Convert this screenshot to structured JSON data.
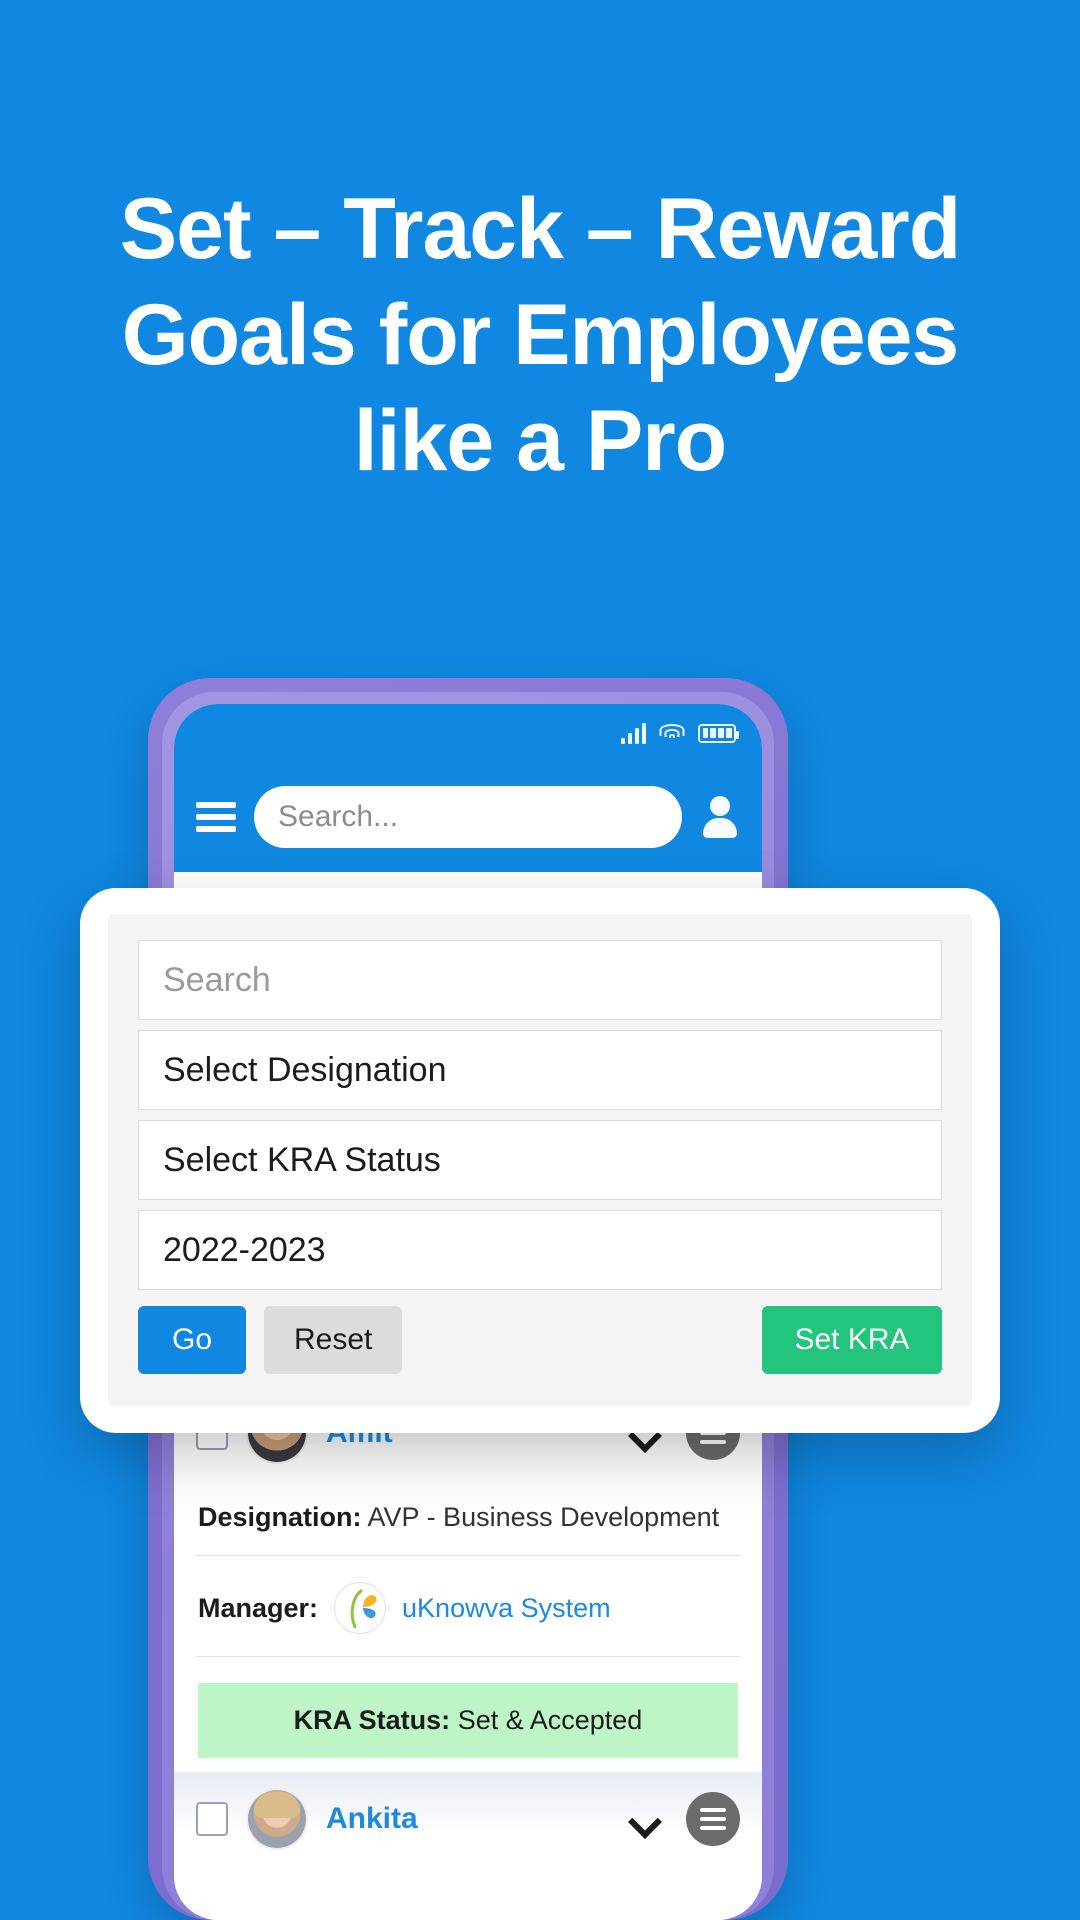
{
  "hero": {
    "line1": "Set – Track – Reward",
    "line2": "Goals for Employees",
    "line3": "like a Pro",
    "bg_color": "#1087e0",
    "text_color": "#ffffff"
  },
  "phone": {
    "frame_color": "#8f7fd8",
    "statusbar": {
      "signal_icon": "signal-bars-icon",
      "wifi_icon": "wifi-icon",
      "battery_icon": "battery-icon"
    },
    "app_header": {
      "menu_icon": "hamburger-icon",
      "search_placeholder": "Search...",
      "profile_icon": "user-avatar-icon",
      "bg_color": "#1087e0"
    }
  },
  "modal": {
    "fields": [
      {
        "name": "search",
        "value": "Search",
        "is_placeholder": true
      },
      {
        "name": "designation",
        "value": "Select Designation",
        "is_placeholder": false
      },
      {
        "name": "kra_status",
        "value": "Select KRA Status",
        "is_placeholder": false
      },
      {
        "name": "year",
        "value": "2022-2023",
        "is_placeholder": false
      }
    ],
    "buttons": {
      "go": "Go",
      "reset": "Reset",
      "set_kra": "Set KRA"
    },
    "colors": {
      "go": "#1087e0",
      "reset": "#dcdcdc",
      "set_kra": "#23c47e"
    }
  },
  "employees": [
    {
      "name": "Amit",
      "gender": "male",
      "designation_label": "Designation:",
      "designation_value": "AVP - Business Development",
      "manager_label": "Manager:",
      "manager_value": "uKnowva System",
      "kra_label": "KRA Status:",
      "kra_value": "Set & Accepted",
      "kra_badge_color": "#bdf5c6",
      "chevron_icon": "chevron-down-icon",
      "row_menu_icon": "row-menu-icon",
      "checkbox_icon": "checkbox-icon"
    },
    {
      "name": "Ankita",
      "gender": "female",
      "chevron_icon": "chevron-down-icon",
      "row_menu_icon": "row-menu-icon",
      "checkbox_icon": "checkbox-icon"
    }
  ]
}
